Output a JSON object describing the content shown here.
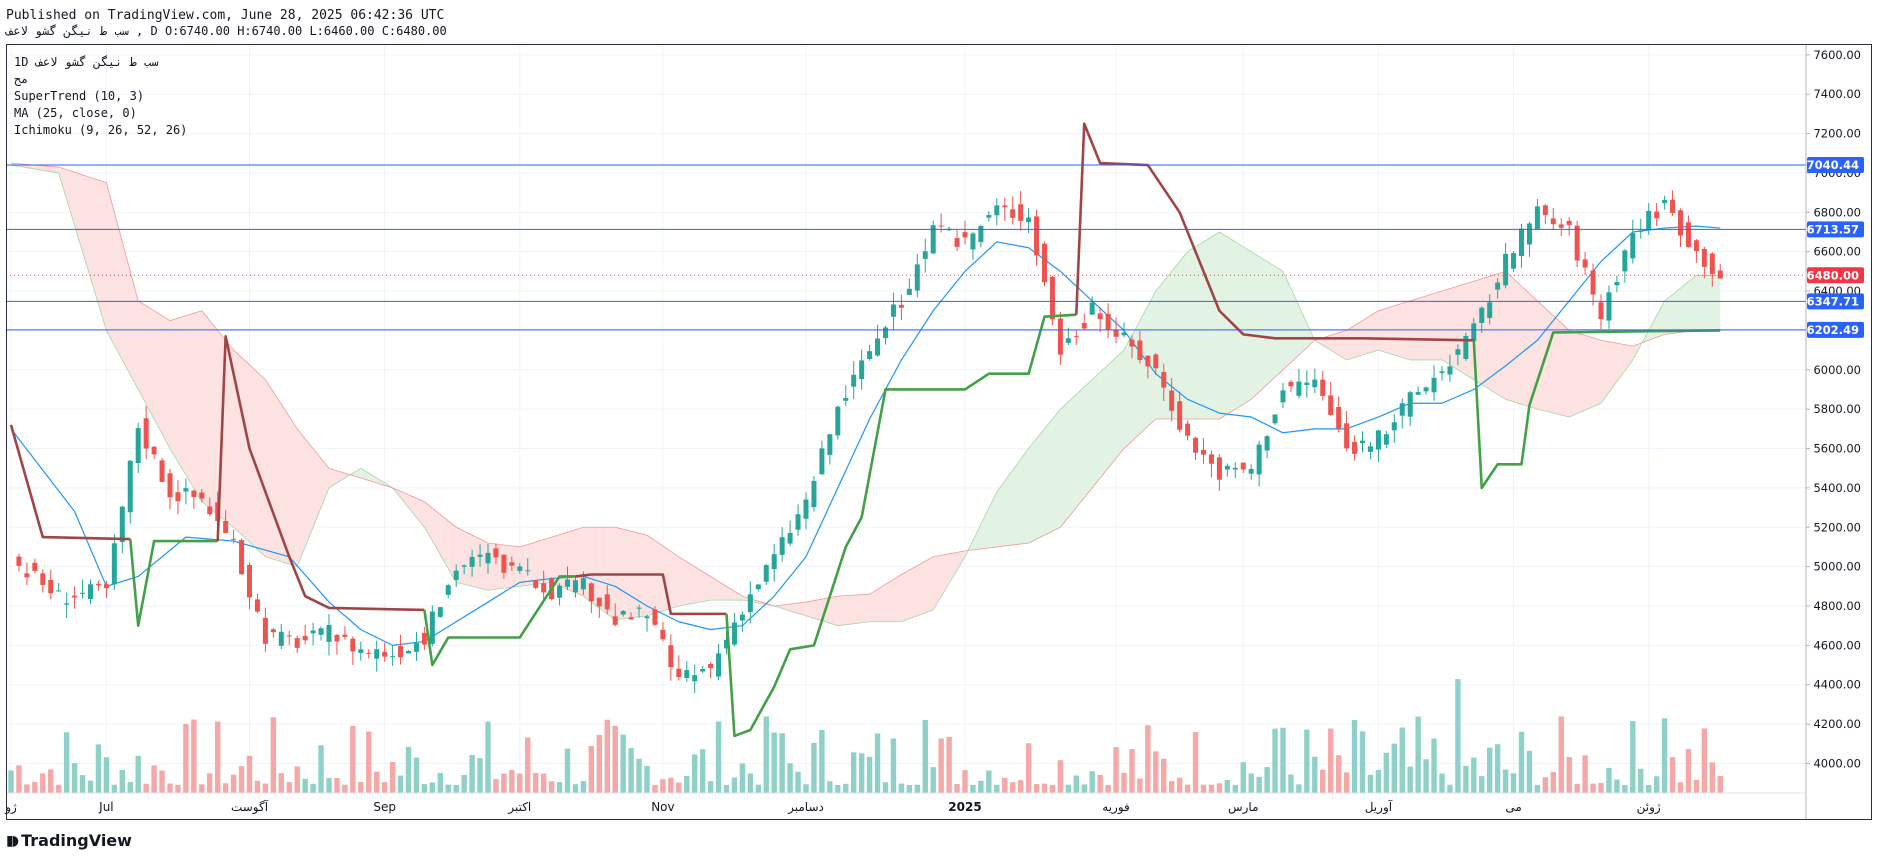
{
  "header": {
    "published": "Published on TradingView.com, June 28, 2025 06:42:36 UTC",
    "symbol_line": "سب ط نیگن گشو لاعف ,  D O:6740.00 H:6740.00 L:6460.00 C:6480.00"
  },
  "legend": {
    "interval_symbol": "1D سب ط نیگن گشو لاعف",
    "sub": "مح",
    "supertrend": "SuperTrend (10, 3)",
    "ma": "MA (25, close, 0)",
    "ichimoku": "Ichimoku (9, 26, 52, 26)"
  },
  "branding": {
    "text": "TradingView",
    "logo_icon": "tradingview-logo-icon"
  },
  "colors": {
    "up": "#26a69a",
    "down": "#ef5350",
    "vol_up": "#8fd1c9",
    "vol_down": "#f4a8a7",
    "supertrend_up": "#43a047",
    "supertrend_down": "#a04545",
    "ma": "#2196f3",
    "cloud_bull": "#e3f3e3",
    "cloud_bear": "#fde2e2",
    "hline": "#2962ff",
    "last_price": "#f23645"
  },
  "chart_data": {
    "type": "candlestick",
    "title": "",
    "xlabel": "",
    "ylabel": "",
    "ylim": [
      3850,
      7650
    ],
    "y_ticks": [
      4000,
      4200,
      4400,
      4600,
      4800,
      5000,
      5200,
      5400,
      5600,
      5800,
      6000,
      6200,
      6400,
      6600,
      6800,
      7000,
      7200,
      7400,
      7600
    ],
    "x_ticks": [
      {
        "label": "ژو",
        "index": 0
      },
      {
        "label": "Jul",
        "index": 12
      },
      {
        "label": "آگوست",
        "index": 30
      },
      {
        "label": "Sep",
        "index": 47
      },
      {
        "label": "اکتبر",
        "index": 64
      },
      {
        "label": "Nov",
        "index": 82
      },
      {
        "label": "دسامبر",
        "index": 100
      },
      {
        "label": "2025",
        "index": 120
      },
      {
        "label": "فوریه",
        "index": 139
      },
      {
        "label": "مارس",
        "index": 155
      },
      {
        "label": "آوریل",
        "index": 172
      },
      {
        "label": "می",
        "index": 189
      },
      {
        "label": "ژوئن",
        "index": 206
      }
    ],
    "horizontal_lines": [
      7040.44,
      6713.57,
      6347.71,
      6202.49
    ],
    "last_price": 6480.0,
    "price_labels": [
      {
        "value": 7040.44,
        "text": "7040.44",
        "color": "#2962ff"
      },
      {
        "value": 6713.57,
        "text": "6713.57",
        "color": "#2962ff"
      },
      {
        "value": 6480.0,
        "text": "6480.00",
        "color": "#f23645"
      },
      {
        "value": 6347.71,
        "text": "6347.71",
        "color": "#2962ff"
      },
      {
        "value": 6202.49,
        "text": "6202.49",
        "color": "#2962ff"
      }
    ],
    "close_anchors": [
      [
        0,
        5040
      ],
      [
        6,
        4850
      ],
      [
        12,
        4880
      ],
      [
        16,
        5720
      ],
      [
        20,
        5380
      ],
      [
        24,
        5350
      ],
      [
        28,
        5100
      ],
      [
        32,
        4650
      ],
      [
        36,
        4620
      ],
      [
        40,
        4660
      ],
      [
        44,
        4580
      ],
      [
        48,
        4560
      ],
      [
        52,
        4640
      ],
      [
        56,
        5000
      ],
      [
        60,
        5050
      ],
      [
        64,
        4960
      ],
      [
        68,
        4880
      ],
      [
        72,
        4900
      ],
      [
        76,
        4730
      ],
      [
        80,
        4760
      ],
      [
        84,
        4420
      ],
      [
        88,
        4480
      ],
      [
        92,
        4800
      ],
      [
        96,
        5050
      ],
      [
        100,
        5330
      ],
      [
        104,
        5800
      ],
      [
        108,
        6100
      ],
      [
        112,
        6350
      ],
      [
        116,
        6700
      ],
      [
        120,
        6650
      ],
      [
        124,
        6820
      ],
      [
        128,
        6780
      ],
      [
        132,
        6100
      ],
      [
        136,
        6300
      ],
      [
        140,
        6150
      ],
      [
        144,
        6000
      ],
      [
        148,
        5650
      ],
      [
        152,
        5480
      ],
      [
        156,
        5500
      ],
      [
        160,
        5900
      ],
      [
        164,
        5950
      ],
      [
        168,
        5600
      ],
      [
        172,
        5650
      ],
      [
        176,
        5850
      ],
      [
        180,
        6000
      ],
      [
        184,
        6200
      ],
      [
        188,
        6550
      ],
      [
        192,
        6800
      ],
      [
        196,
        6700
      ],
      [
        200,
        6280
      ],
      [
        204,
        6700
      ],
      [
        208,
        6850
      ],
      [
        212,
        6600
      ],
      [
        215,
        6480
      ]
    ],
    "supertrend": [
      {
        "trend": "down",
        "points": [
          [
            0,
            5720
          ],
          [
            4,
            5150
          ],
          [
            15,
            5140
          ]
        ]
      },
      {
        "trend": "up",
        "points": [
          [
            15,
            5140
          ],
          [
            16,
            4700
          ],
          [
            18,
            5130
          ],
          [
            26,
            5130
          ]
        ]
      },
      {
        "trend": "down",
        "points": [
          [
            26,
            5130
          ],
          [
            27,
            6170
          ],
          [
            30,
            5600
          ],
          [
            35,
            5050
          ],
          [
            37,
            4850
          ],
          [
            40,
            4790
          ],
          [
            52,
            4780
          ]
        ]
      },
      {
        "trend": "up",
        "points": [
          [
            52,
            4780
          ],
          [
            53,
            4500
          ],
          [
            55,
            4640
          ],
          [
            64,
            4640
          ],
          [
            69,
            4950
          ],
          [
            71,
            4950
          ]
        ]
      },
      {
        "trend": "down",
        "points": [
          [
            71,
            4950
          ],
          [
            73,
            4960
          ],
          [
            82,
            4960
          ],
          [
            83,
            4760
          ],
          [
            90,
            4760
          ]
        ]
      },
      {
        "trend": "up",
        "points": [
          [
            90,
            4760
          ],
          [
            91,
            4140
          ],
          [
            93,
            4170
          ],
          [
            96,
            4390
          ],
          [
            98,
            4580
          ],
          [
            101,
            4600
          ],
          [
            105,
            5100
          ],
          [
            107,
            5250
          ],
          [
            110,
            5900
          ],
          [
            120,
            5900
          ],
          [
            123,
            5980
          ],
          [
            128,
            5980
          ],
          [
            130,
            6270
          ],
          [
            134,
            6280
          ]
        ]
      },
      {
        "trend": "down",
        "points": [
          [
            134,
            6280
          ],
          [
            135,
            7250
          ],
          [
            137,
            7050
          ],
          [
            143,
            7040
          ],
          [
            147,
            6800
          ],
          [
            152,
            6300
          ],
          [
            155,
            6180
          ],
          [
            159,
            6160
          ],
          [
            170,
            6160
          ],
          [
            184,
            6150
          ]
        ]
      },
      {
        "trend": "up",
        "points": [
          [
            184,
            6150
          ],
          [
            185,
            5400
          ],
          [
            187,
            5520
          ],
          [
            190,
            5520
          ],
          [
            191,
            5820
          ],
          [
            194,
            6190
          ],
          [
            215,
            6200
          ]
        ]
      }
    ],
    "ma": [
      [
        0,
        5700
      ],
      [
        8,
        5280
      ],
      [
        12,
        4900
      ],
      [
        16,
        4950
      ],
      [
        22,
        5150
      ],
      [
        28,
        5130
      ],
      [
        35,
        5050
      ],
      [
        40,
        4820
      ],
      [
        44,
        4680
      ],
      [
        48,
        4600
      ],
      [
        52,
        4620
      ],
      [
        56,
        4720
      ],
      [
        60,
        4820
      ],
      [
        64,
        4920
      ],
      [
        68,
        4940
      ],
      [
        72,
        4950
      ],
      [
        76,
        4900
      ],
      [
        80,
        4800
      ],
      [
        84,
        4720
      ],
      [
        88,
        4680
      ],
      [
        92,
        4700
      ],
      [
        96,
        4850
      ],
      [
        100,
        5050
      ],
      [
        104,
        5400
      ],
      [
        108,
        5750
      ],
      [
        112,
        6050
      ],
      [
        116,
        6300
      ],
      [
        120,
        6500
      ],
      [
        124,
        6650
      ],
      [
        128,
        6620
      ],
      [
        132,
        6500
      ],
      [
        136,
        6350
      ],
      [
        140,
        6200
      ],
      [
        144,
        5980
      ],
      [
        148,
        5850
      ],
      [
        152,
        5780
      ],
      [
        156,
        5760
      ],
      [
        160,
        5680
      ],
      [
        164,
        5700
      ],
      [
        168,
        5700
      ],
      [
        172,
        5760
      ],
      [
        176,
        5830
      ],
      [
        180,
        5830
      ],
      [
        184,
        5900
      ],
      [
        188,
        6020
      ],
      [
        192,
        6150
      ],
      [
        196,
        6350
      ],
      [
        200,
        6550
      ],
      [
        204,
        6700
      ],
      [
        208,
        6720
      ],
      [
        212,
        6730
      ],
      [
        215,
        6720
      ]
    ],
    "ichimoku_cloud": {
      "span_a": [
        [
          0,
          7040
        ],
        [
          6,
          7000
        ],
        [
          12,
          6200
        ],
        [
          16,
          5900
        ],
        [
          20,
          5600
        ],
        [
          24,
          5330
        ],
        [
          28,
          5200
        ],
        [
          32,
          5050
        ],
        [
          36,
          5000
        ],
        [
          40,
          5400
        ],
        [
          44,
          5500
        ],
        [
          48,
          5400
        ],
        [
          52,
          5200
        ],
        [
          56,
          4920
        ],
        [
          60,
          4880
        ],
        [
          64,
          4900
        ],
        [
          68,
          4920
        ],
        [
          72,
          4850
        ],
        [
          76,
          4730
        ],
        [
          80,
          4750
        ],
        [
          84,
          4800
        ],
        [
          88,
          4830
        ],
        [
          92,
          4830
        ],
        [
          96,
          4800
        ],
        [
          100,
          4750
        ],
        [
          104,
          4700
        ],
        [
          108,
          4720
        ],
        [
          112,
          4720
        ],
        [
          116,
          4780
        ],
        [
          120,
          5050
        ],
        [
          124,
          5380
        ],
        [
          128,
          5600
        ],
        [
          132,
          5800
        ],
        [
          136,
          5950
        ],
        [
          140,
          6100
        ],
        [
          144,
          6400
        ],
        [
          148,
          6600
        ],
        [
          152,
          6700
        ],
        [
          156,
          6600
        ],
        [
          160,
          6500
        ],
        [
          164,
          6150
        ],
        [
          168,
          6050
        ],
        [
          172,
          6100
        ],
        [
          176,
          6050
        ],
        [
          180,
          6050
        ],
        [
          184,
          5950
        ],
        [
          188,
          5850
        ],
        [
          192,
          5800
        ],
        [
          196,
          5760
        ],
        [
          200,
          5830
        ],
        [
          204,
          6050
        ],
        [
          208,
          6350
        ],
        [
          212,
          6480
        ],
        [
          215,
          6480
        ]
      ],
      "span_b": [
        [
          0,
          7050
        ],
        [
          6,
          7030
        ],
        [
          12,
          6950
        ],
        [
          16,
          6350
        ],
        [
          20,
          6250
        ],
        [
          24,
          6300
        ],
        [
          28,
          6100
        ],
        [
          32,
          5950
        ],
        [
          36,
          5700
        ],
        [
          40,
          5500
        ],
        [
          44,
          5450
        ],
        [
          48,
          5400
        ],
        [
          52,
          5330
        ],
        [
          56,
          5200
        ],
        [
          60,
          5120
        ],
        [
          64,
          5100
        ],
        [
          68,
          5150
        ],
        [
          72,
          5200
        ],
        [
          76,
          5200
        ],
        [
          80,
          5160
        ],
        [
          84,
          5050
        ],
        [
          88,
          4950
        ],
        [
          92,
          4850
        ],
        [
          96,
          4800
        ],
        [
          100,
          4820
        ],
        [
          104,
          4850
        ],
        [
          108,
          4860
        ],
        [
          112,
          4960
        ],
        [
          116,
          5050
        ],
        [
          120,
          5080
        ],
        [
          124,
          5100
        ],
        [
          128,
          5120
        ],
        [
          132,
          5200
        ],
        [
          136,
          5400
        ],
        [
          140,
          5600
        ],
        [
          144,
          5750
        ],
        [
          148,
          5750
        ],
        [
          152,
          5750
        ],
        [
          156,
          5850
        ],
        [
          160,
          6000
        ],
        [
          164,
          6150
        ],
        [
          168,
          6200
        ],
        [
          172,
          6300
        ],
        [
          176,
          6350
        ],
        [
          180,
          6400
        ],
        [
          184,
          6450
        ],
        [
          188,
          6500
        ],
        [
          192,
          6350
        ],
        [
          196,
          6200
        ],
        [
          200,
          6150
        ],
        [
          204,
          6120
        ],
        [
          208,
          6180
        ],
        [
          212,
          6200
        ],
        [
          215,
          6200
        ]
      ]
    }
  }
}
